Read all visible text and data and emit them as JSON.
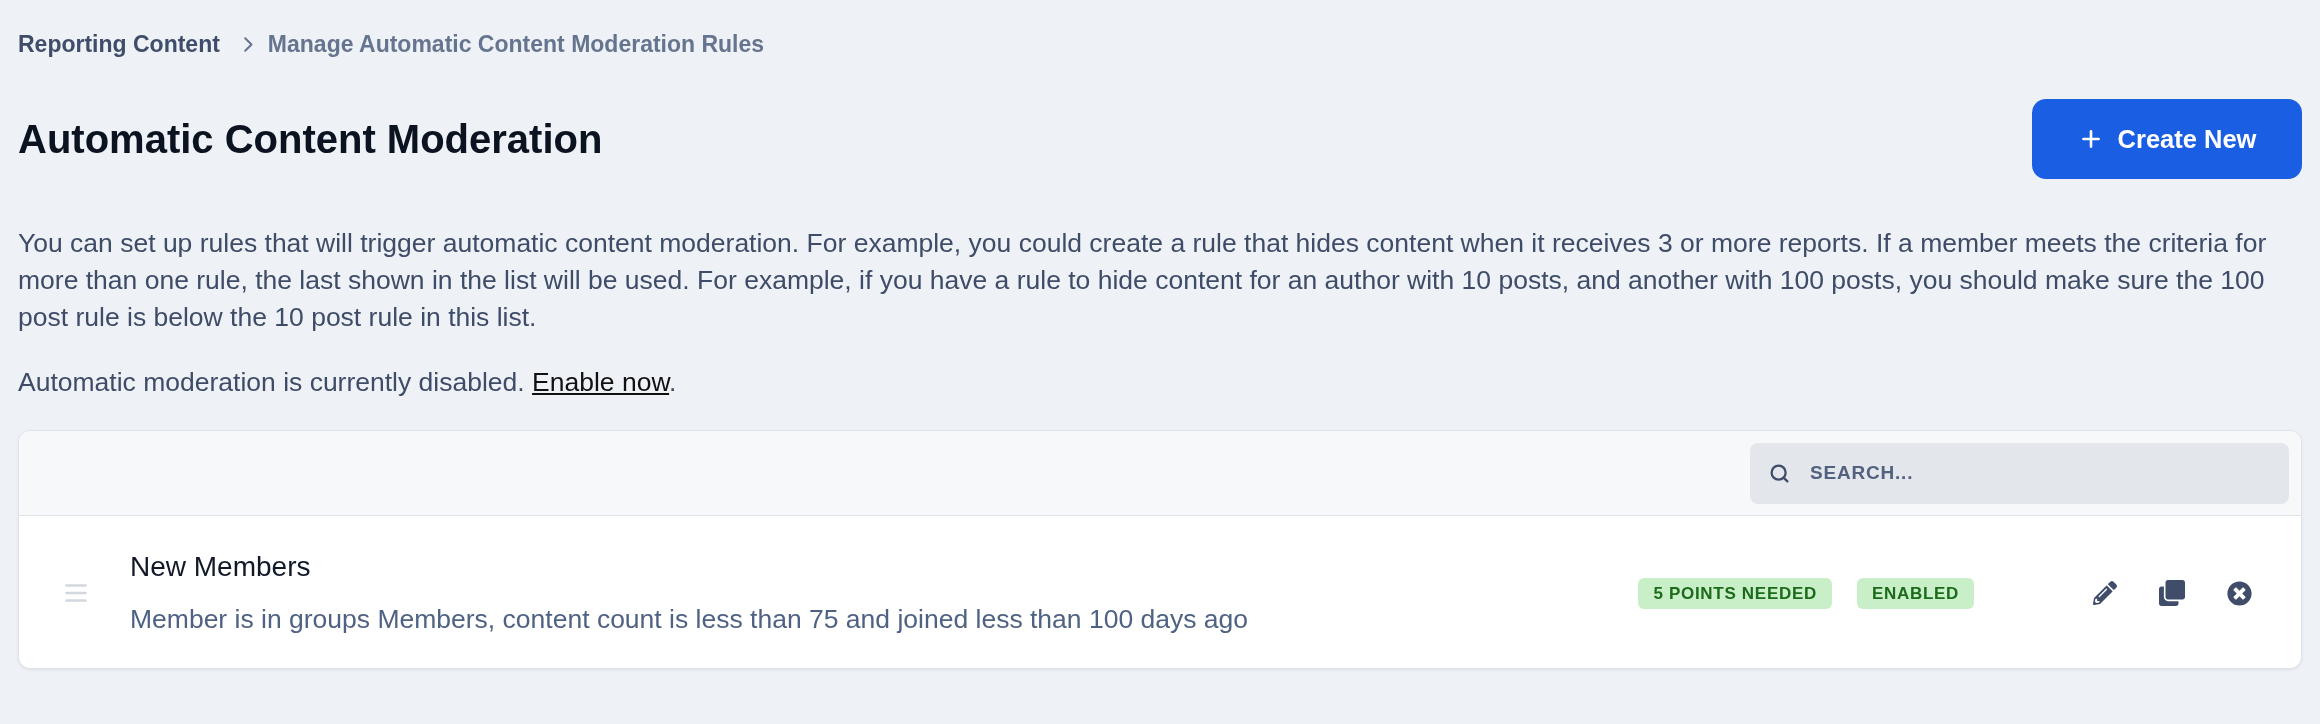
{
  "breadcrumb": [
    {
      "label": "Reporting Content",
      "current": false
    },
    {
      "label": "Manage Automatic Content Moderation Rules",
      "current": true
    }
  ],
  "header": {
    "title": "Automatic Content Moderation",
    "create_button": "Create New"
  },
  "intro": "You can set up rules that will trigger automatic content moderation. For example, you could create a rule that hides content when it receives 3 or more reports. If a member meets the criteria for more than one rule, the last shown in the list will be used. For example, if you have a rule to hide content for an author with 10 posts, and another with 100 posts, you should make sure the 100 post rule is below the 10 post rule in this list.",
  "status": {
    "text": "Automatic moderation is currently disabled.",
    "link": "Enable now",
    "suffix": "."
  },
  "search": {
    "placeholder": "SEARCH..."
  },
  "rules": [
    {
      "title": "New Members",
      "summary": "Member is in groups Members, content count is less than 75 and joined less than 100 days ago",
      "badges": [
        "5 POINTS NEEDED",
        "ENABLED"
      ]
    }
  ]
}
